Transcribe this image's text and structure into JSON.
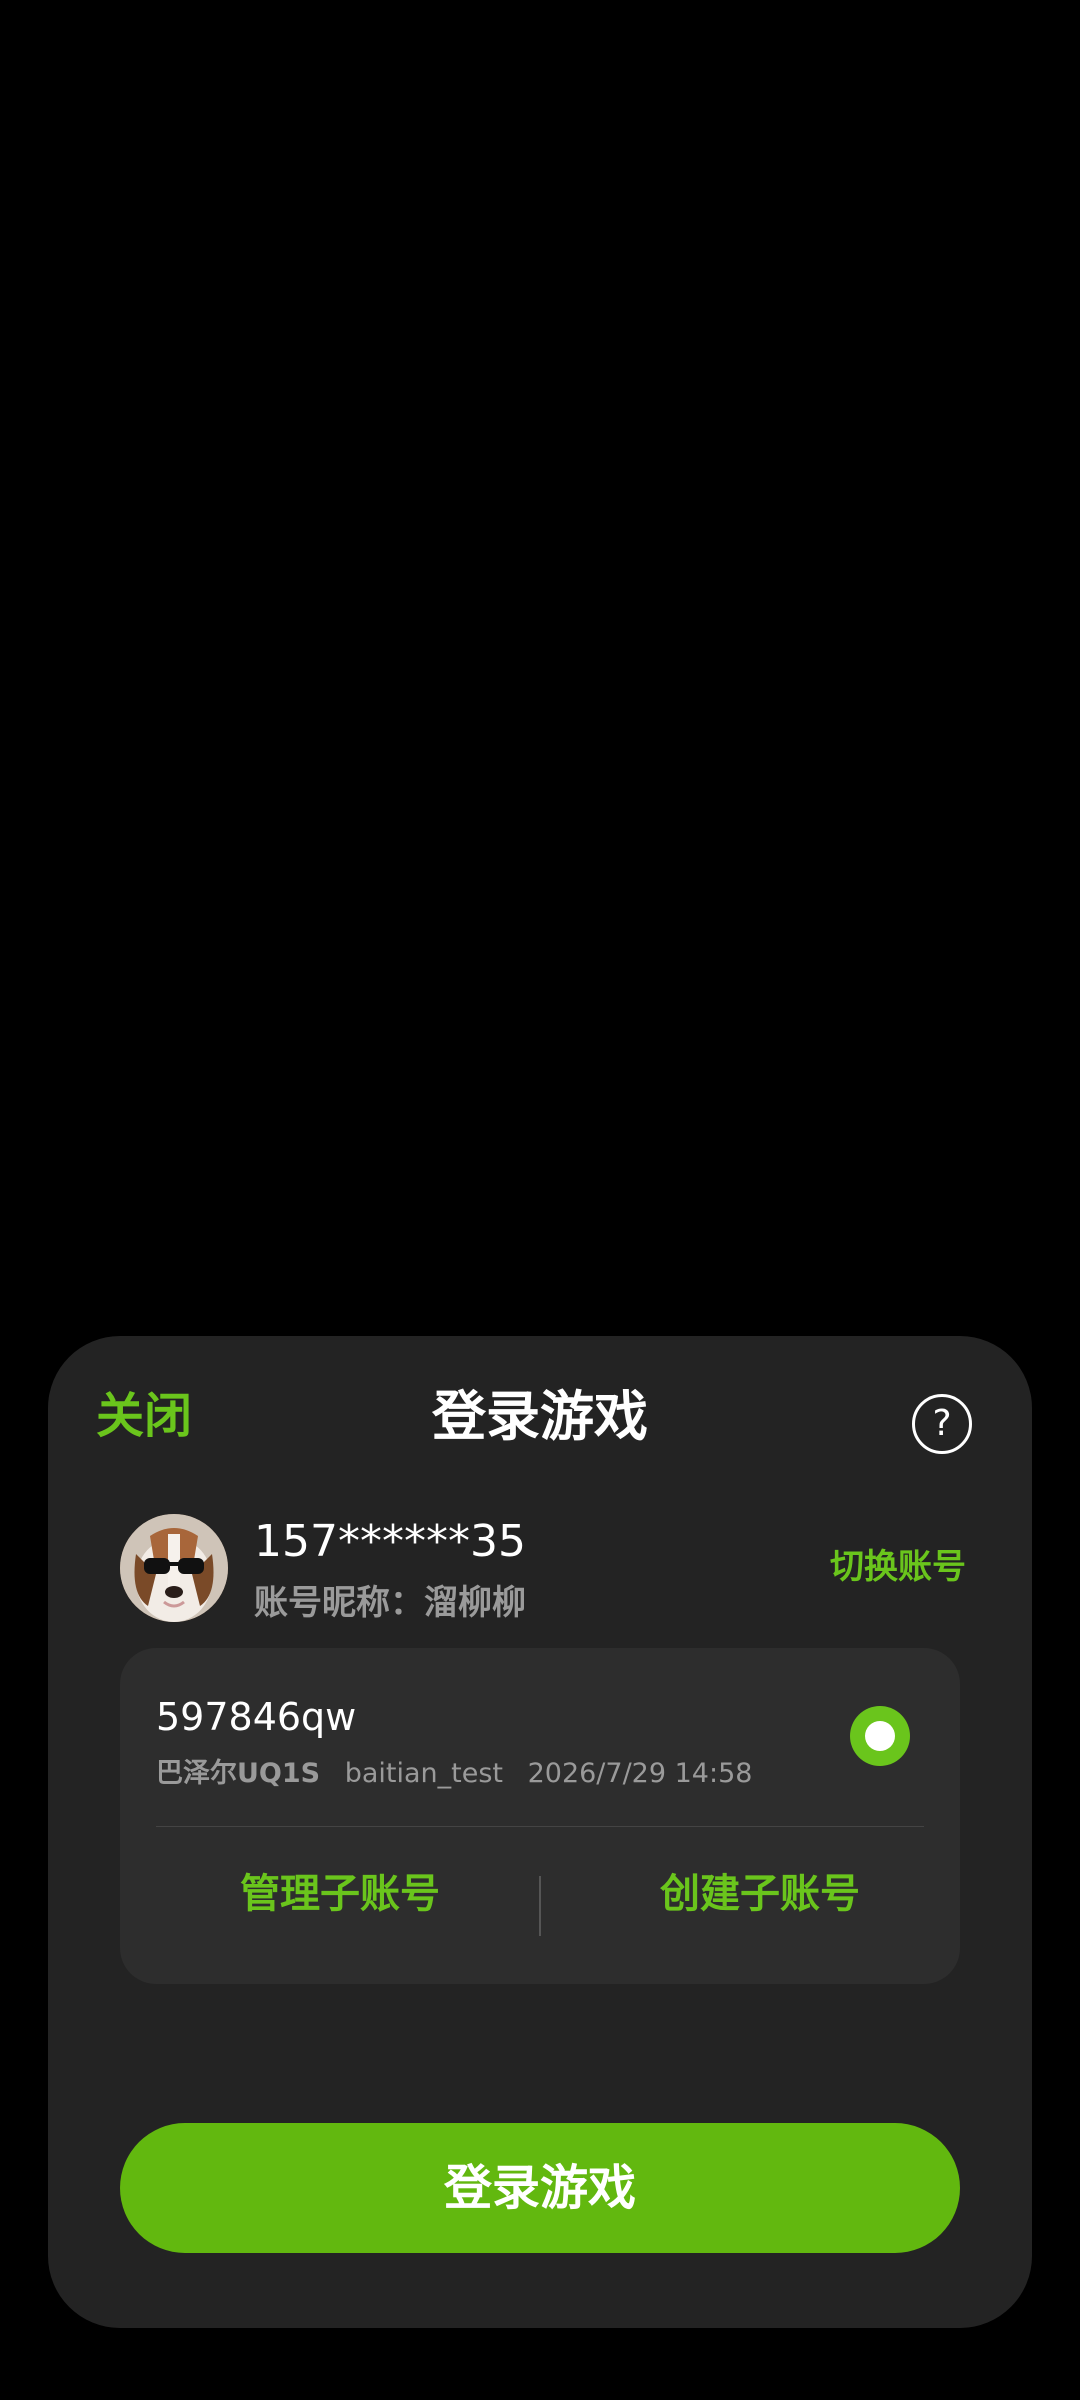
{
  "header": {
    "close_label": "关闭",
    "title": "登录游戏",
    "help_symbol": "?"
  },
  "account": {
    "phone": "157******35",
    "nickname": "账号昵称：溜柳柳",
    "switch_label": "切换账号",
    "avatar_icon": "beagle-sunglasses-avatar"
  },
  "sub_account": {
    "id": "597846qw",
    "server": "巴泽尔UQ1S",
    "name": "baitian_test",
    "datetime": "2026/7/29 14:58",
    "selected": true
  },
  "actions": {
    "manage_label": "管理子账号",
    "create_label": "创建子账号"
  },
  "login_button_label": "登录游戏",
  "colors": {
    "accent": "#6ac51c",
    "button": "#62b80f",
    "sheet_bg": "#232323",
    "card_bg": "#2d2d2d"
  }
}
